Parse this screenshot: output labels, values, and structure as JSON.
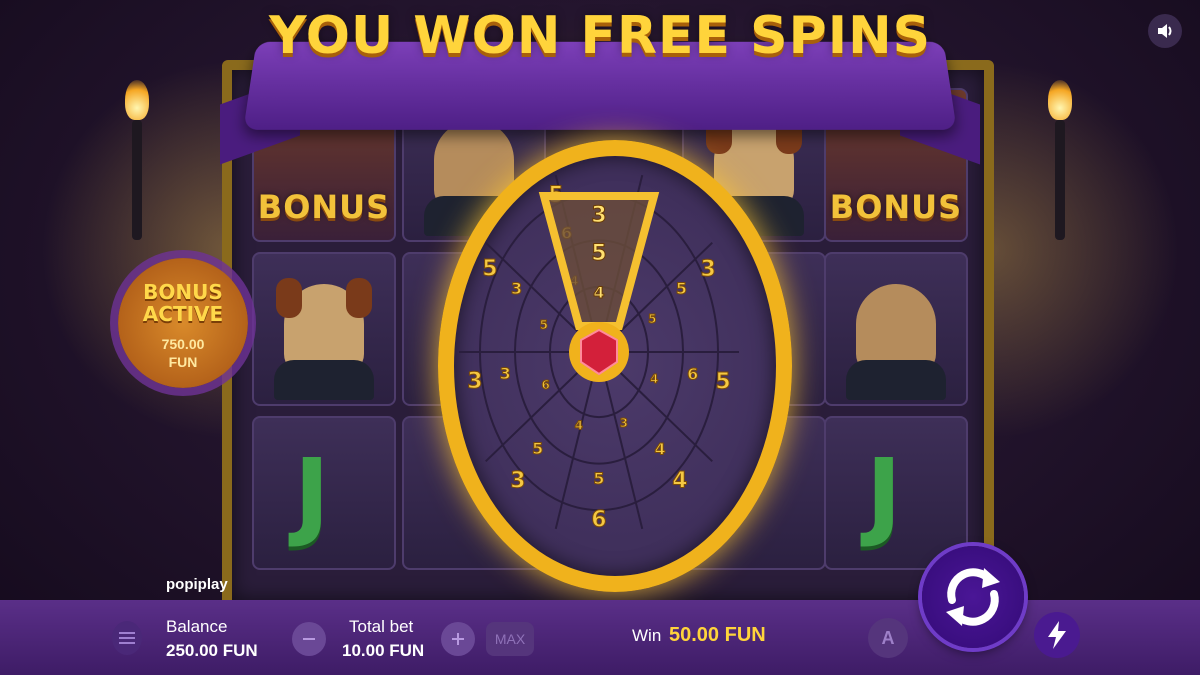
{
  "banner": {
    "title": "YOU WON FREE SPINS"
  },
  "reels": {
    "bonus_symbol_label": "BONUS",
    "letter_symbol": "J"
  },
  "bonus_badge": {
    "line1": "BONUS",
    "line2": "ACTIVE",
    "amount": "750.00",
    "currency": "FUN"
  },
  "wheel": {
    "pointer_values": [
      "3",
      "5",
      "4"
    ],
    "segment_values": [
      "5",
      "4",
      "3",
      "4",
      "6",
      "5",
      "4",
      "5",
      "6",
      "4",
      "5",
      "5",
      "3",
      "3",
      "6",
      "3",
      "5",
      "4",
      "6",
      "3",
      "3",
      "5",
      "5"
    ],
    "accent_color": "#f0b21c",
    "gem_color": "#d3203a"
  },
  "brand": {
    "name": "popiplay"
  },
  "bottom_bar": {
    "balance_label": "Balance",
    "balance_value": "250.00 FUN",
    "total_bet_label": "Total bet",
    "total_bet_value": "10.00 FUN",
    "max_label": "MAX",
    "win_label": "Win",
    "win_value": "50.00 FUN",
    "auto_label": "A"
  },
  "icons": {
    "sound": "speaker-icon",
    "menu": "menu-icon",
    "minus": "minus-icon",
    "plus": "plus-icon",
    "spin": "spin-arrows-icon",
    "turbo": "lightning-icon"
  },
  "colors": {
    "win_value": "#ffd43b",
    "bar_bg": "#4a2478",
    "banner_text": "#ffd43b"
  }
}
